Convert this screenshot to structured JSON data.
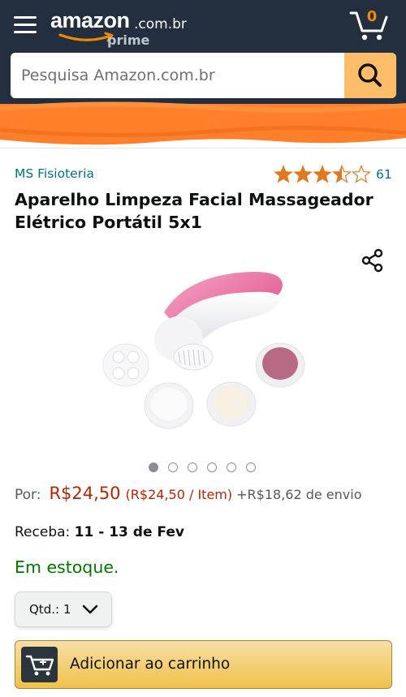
{
  "header": {
    "logo_word": "amazon",
    "logo_domain": ".com.br",
    "logo_sub": "prime",
    "cart_count": "0",
    "background_color": "#232f3e"
  },
  "search": {
    "placeholder": "Pesquisa Amazon.com.br",
    "button_color": "#febd69"
  },
  "redaction_color": "#ff7f2a",
  "product": {
    "brand": "MS Fisioteria",
    "rating": 3.5,
    "rating_max": 5,
    "review_count": "61",
    "title": "Aparelho Limpeza Facial Massageador Elétrico Portátil 5x1",
    "image_count": 6,
    "active_image_index": 0
  },
  "pricing": {
    "prefix": "Por:",
    "price": "R$24,50",
    "unit_price": "(R$24,50 / Item)",
    "shipping": "+R$18,62 de envio"
  },
  "delivery": {
    "label": "Receba:",
    "dates": "11 - 13 de Fev"
  },
  "stock_status": "Em estoque.",
  "quantity": {
    "label": "Qtd.:",
    "value": "1"
  },
  "add_to_cart": {
    "label": "Adicionar ao carrinho"
  },
  "colors": {
    "link": "#007185",
    "price": "#b12704",
    "stock": "#007600",
    "star": "#de7921"
  }
}
